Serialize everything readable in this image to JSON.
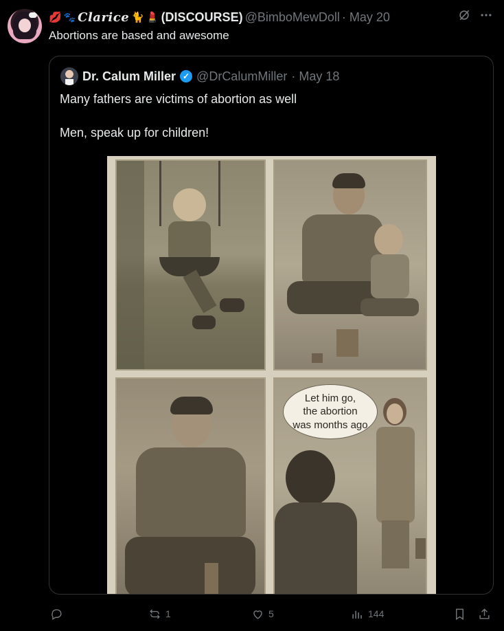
{
  "tweet": {
    "name": "Clarice",
    "name_suffix": "(DISCOURSE)",
    "handle": "@BimboMewDoll",
    "date": "· May 20",
    "text": "Abortions are based and awesome"
  },
  "quote": {
    "name": "Dr. Calum Miller",
    "handle": "@DrCalumMiller",
    "date": "· May 18",
    "line1": "Many fathers are victims of abortion as well",
    "line2": "Men, speak up for children!",
    "speech": [
      "Let him go,",
      "the abortion",
      "was months ago"
    ]
  },
  "actions": {
    "reply_count": "",
    "retweet_count": "1",
    "like_count": "5",
    "views_count": "144"
  },
  "icons": {
    "top": [
      "grok-icon",
      "more-icon"
    ],
    "footer": [
      "reply-icon",
      "retweet-icon",
      "like-icon",
      "views-icon",
      "bookmark-icon",
      "share-icon"
    ]
  },
  "colors": {
    "background": "#000000",
    "text": "#e7e9ea",
    "secondary": "#71767b",
    "verified": "#1d9bf0",
    "border": "#2f3336"
  }
}
